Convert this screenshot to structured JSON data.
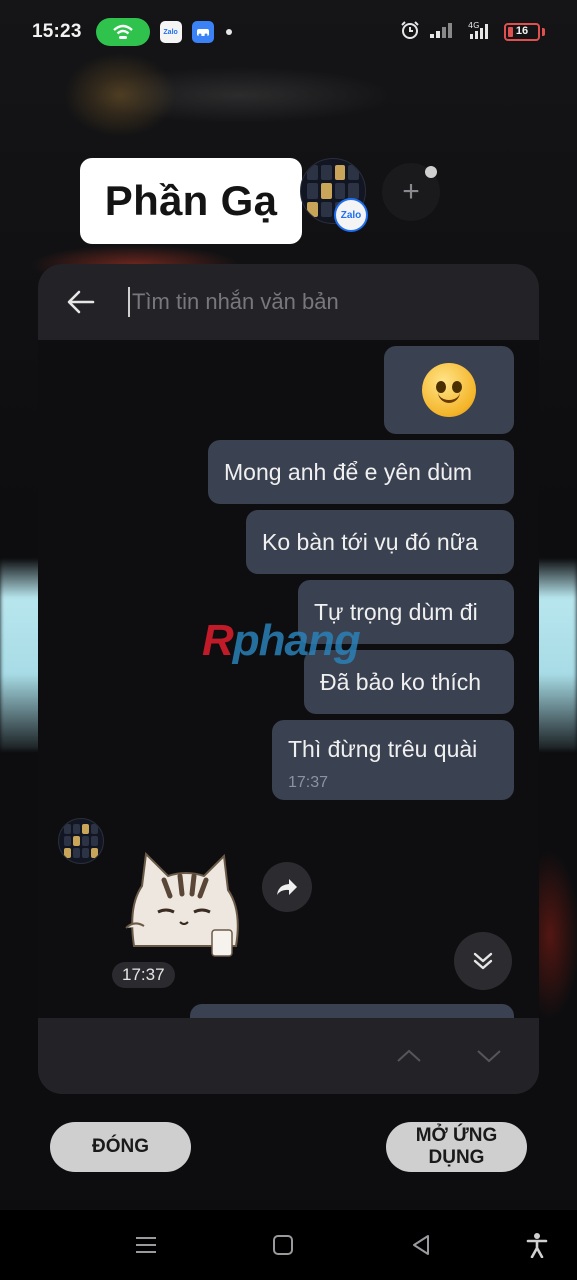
{
  "status_bar": {
    "time": "15:23",
    "notification_apps": [
      "Zalo",
      "app"
    ],
    "battery_level": "16",
    "network": "4G"
  },
  "conversation": {
    "title": "Phần Gạ"
  },
  "search": {
    "placeholder": "Tìm tin nhắn văn bản",
    "value": ""
  },
  "messages": {
    "emoji": "🙂",
    "m1": "Mong anh để e yên dùm",
    "m2": "Ko bàn tới vụ đó nữa",
    "m3": "Tự trọng dùm đi",
    "m4": "Đã bảo ko thích",
    "m5": "Thì đừng trêu quài",
    "m5_time": "17:37",
    "sticker_time": "17:37"
  },
  "watermark": {
    "first": "R",
    "rest": "phang"
  },
  "buttons": {
    "close": "ĐÓNG",
    "open_app": "MỞ ỨNG DỤNG"
  },
  "colors": {
    "bubble": "#3a4150",
    "hotspot": "#2fc24d",
    "battery_low": "#e05050"
  }
}
